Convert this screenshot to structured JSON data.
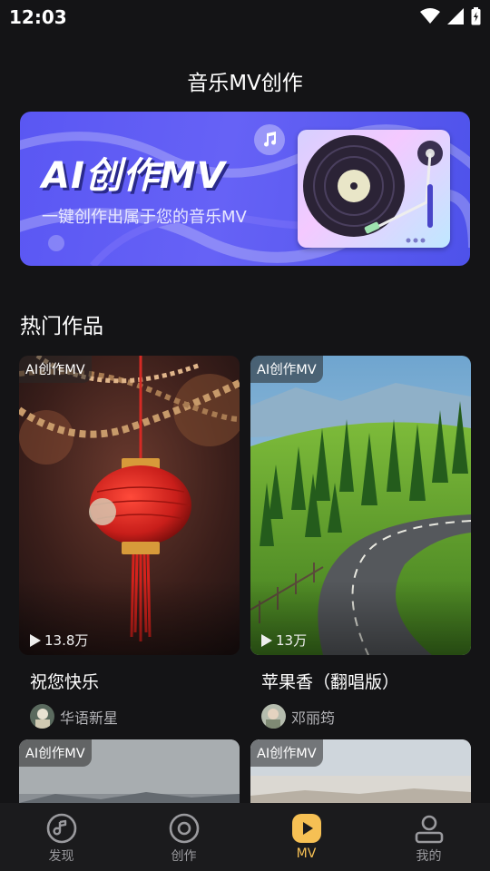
{
  "status_bar": {
    "time": "12:03"
  },
  "header": {
    "title": "音乐MV创作"
  },
  "banner": {
    "title": "AI创作MV",
    "subtitle": "一键创作出属于您的音乐MV"
  },
  "section": {
    "title": "热门作品"
  },
  "cards": [
    {
      "badge": "AI创作MV",
      "plays": "13.8万",
      "title": "祝您快乐",
      "author": "华语新星"
    },
    {
      "badge": "AI创作MV",
      "plays": "13万",
      "title": "苹果香（翻唱版）",
      "author": "邓丽筠"
    },
    {
      "badge": "AI创作MV"
    },
    {
      "badge": "AI创作MV"
    }
  ],
  "tabbar": {
    "items": [
      {
        "label": "发现",
        "icon": "music-note-icon"
      },
      {
        "label": "创作",
        "icon": "disc-icon"
      },
      {
        "label": "MV",
        "icon": "play-icon"
      },
      {
        "label": "我的",
        "icon": "person-icon"
      }
    ],
    "active_index": 2,
    "active_color": "#f6c054",
    "inactive_color": "#9a9a9e"
  },
  "colors": {
    "background": "#141416",
    "banner": "#5a57f3",
    "accent": "#f6c054"
  }
}
